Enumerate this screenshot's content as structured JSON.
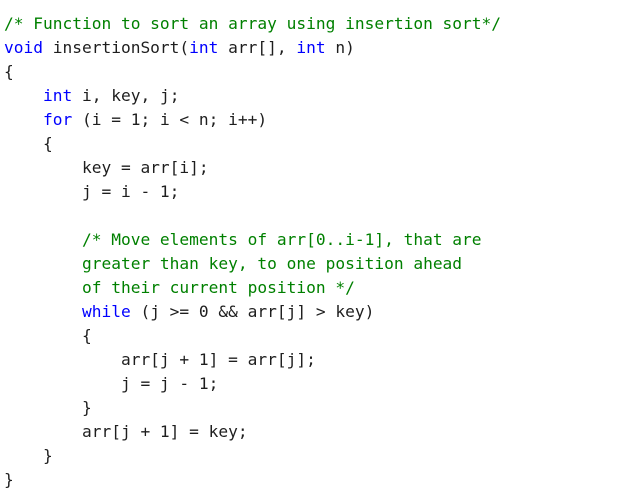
{
  "editor": {
    "language": "C",
    "colors": {
      "background": "#ffffff",
      "text": "#1e1e1e",
      "comment": "#008000",
      "keyword": "#0000ff",
      "type": "#2b91af"
    },
    "lines": [
      {
        "tokens": [
          {
            "t": "/* Function to sort an array using insertion sort*/",
            "k": "comment"
          }
        ]
      },
      {
        "tokens": [
          {
            "t": "void",
            "k": "keyword"
          },
          {
            "t": " insertionSort(",
            "k": "plain"
          },
          {
            "t": "int",
            "k": "keyword"
          },
          {
            "t": " arr[], ",
            "k": "plain"
          },
          {
            "t": "int",
            "k": "keyword"
          },
          {
            "t": " n)",
            "k": "plain"
          }
        ]
      },
      {
        "tokens": [
          {
            "t": "{",
            "k": "punct"
          }
        ]
      },
      {
        "tokens": [
          {
            "t": "    ",
            "k": "plain"
          },
          {
            "t": "int",
            "k": "keyword"
          },
          {
            "t": " i, key, j;",
            "k": "plain"
          }
        ]
      },
      {
        "tokens": [
          {
            "t": "    ",
            "k": "plain"
          },
          {
            "t": "for",
            "k": "keyword"
          },
          {
            "t": " (i = 1; i < n; i++)",
            "k": "plain"
          }
        ]
      },
      {
        "tokens": [
          {
            "t": "    {",
            "k": "punct"
          }
        ]
      },
      {
        "tokens": [
          {
            "t": "        key = arr[i];",
            "k": "plain"
          }
        ]
      },
      {
        "tokens": [
          {
            "t": "        j = i - 1;",
            "k": "plain"
          }
        ]
      },
      {
        "tokens": [
          {
            "t": "",
            "k": "plain"
          }
        ]
      },
      {
        "tokens": [
          {
            "t": "        ",
            "k": "plain"
          },
          {
            "t": "/* Move elements of arr[0..i-1], that are",
            "k": "comment"
          }
        ]
      },
      {
        "tokens": [
          {
            "t": "        ",
            "k": "plain"
          },
          {
            "t": "greater than key, to one position ahead",
            "k": "comment"
          }
        ]
      },
      {
        "tokens": [
          {
            "t": "        ",
            "k": "plain"
          },
          {
            "t": "of their current position */",
            "k": "comment"
          }
        ]
      },
      {
        "tokens": [
          {
            "t": "        ",
            "k": "plain"
          },
          {
            "t": "while",
            "k": "keyword"
          },
          {
            "t": " (j >= 0 && arr[j] > key)",
            "k": "plain"
          }
        ]
      },
      {
        "tokens": [
          {
            "t": "        {",
            "k": "punct"
          }
        ]
      },
      {
        "tokens": [
          {
            "t": "            arr[j + 1] = arr[j];",
            "k": "plain"
          }
        ]
      },
      {
        "tokens": [
          {
            "t": "            j = j - 1;",
            "k": "plain"
          }
        ]
      },
      {
        "tokens": [
          {
            "t": "        }",
            "k": "punct"
          }
        ]
      },
      {
        "tokens": [
          {
            "t": "        arr[j + 1] = key;",
            "k": "plain"
          }
        ]
      },
      {
        "tokens": [
          {
            "t": "    }",
            "k": "punct"
          }
        ]
      },
      {
        "tokens": [
          {
            "t": "}",
            "k": "punct"
          }
        ]
      }
    ]
  }
}
